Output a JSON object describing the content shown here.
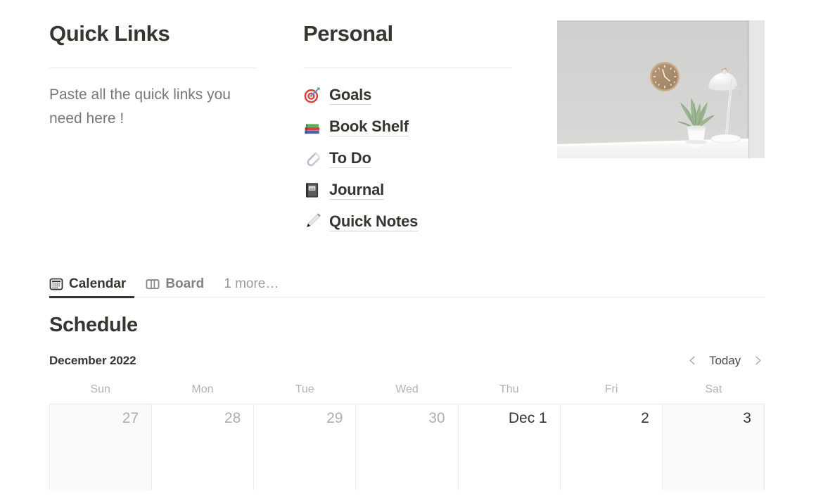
{
  "quick_links": {
    "title": "Quick Links",
    "body": "Paste all the quick links you need here !"
  },
  "personal": {
    "title": "Personal",
    "items": [
      {
        "label": "Goals",
        "icon": "dart-target-icon"
      },
      {
        "label": "Book Shelf",
        "icon": "books-icon"
      },
      {
        "label": "To Do",
        "icon": "paperclip-icon"
      },
      {
        "label": "Journal",
        "icon": "notebook-icon"
      },
      {
        "label": "Quick Notes",
        "icon": "pen-icon"
      }
    ]
  },
  "photo": {
    "alt": "Minimal interior: wooden wall clock, white desk lamp and potted plant on a white desk"
  },
  "tabs": {
    "items": [
      {
        "label": "Calendar",
        "icon": "calendar-icon",
        "active": true
      },
      {
        "label": "Board",
        "icon": "board-columns-icon",
        "active": false
      }
    ],
    "more_label": "1 more…"
  },
  "schedule": {
    "title": "Schedule",
    "month_label": "December 2022",
    "nav": {
      "prev_icon": "chevron-left-icon",
      "today_label": "Today",
      "next_icon": "chevron-right-icon"
    },
    "weekdays": [
      "Sun",
      "Mon",
      "Tue",
      "Wed",
      "Thu",
      "Fri",
      "Sat"
    ],
    "days": [
      {
        "label": "27",
        "muted": true,
        "weekend": true
      },
      {
        "label": "28",
        "muted": true,
        "weekend": false
      },
      {
        "label": "29",
        "muted": true,
        "weekend": false
      },
      {
        "label": "30",
        "muted": true,
        "weekend": false
      },
      {
        "label": "Dec 1",
        "muted": false,
        "weekend": false
      },
      {
        "label": "2",
        "muted": false,
        "weekend": false
      },
      {
        "label": "3",
        "muted": false,
        "weekend": true
      }
    ]
  },
  "colors": {
    "text_primary": "#37352f",
    "text_muted": "#787774",
    "text_light": "#b4b3b0",
    "rule": "#e9e9e7",
    "grid_line": "#ecebe9",
    "weekend_bg": "#fafafa",
    "active_tab_underline": "#37352f"
  }
}
